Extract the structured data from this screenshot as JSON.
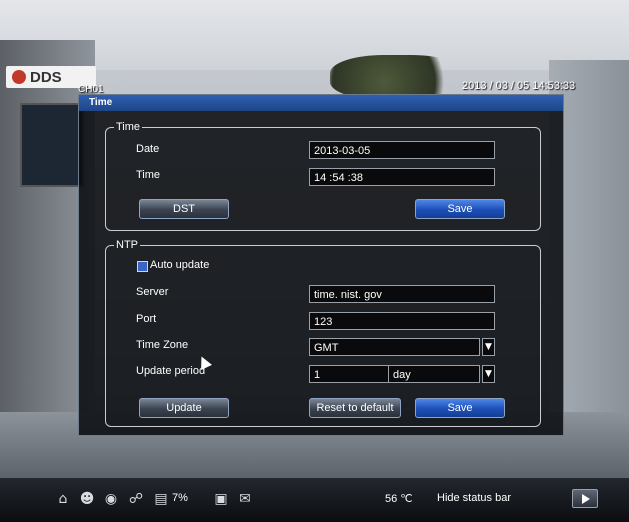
{
  "overlay": {
    "logo_text": "DDS",
    "camera_label": "CH01",
    "camera_timestamp": "2013 / 03 / 05  14:53:33"
  },
  "dialog": {
    "title": "Time",
    "time_group": {
      "legend": "Time",
      "date_label": "Date",
      "date_value": "2013-03-05",
      "time_label": "Time",
      "time_value": "14 :54 :38",
      "dst_button": "DST",
      "save_button": "Save"
    },
    "ntp_group": {
      "legend": "NTP",
      "auto_update_label": "Auto update",
      "auto_update_checked": true,
      "server_label": "Server",
      "server_value": "time. nist. gov",
      "port_label": "Port",
      "port_value": "123",
      "timezone_label": "Time  Zone",
      "timezone_value": "GMT",
      "update_period_label": "Update  period",
      "update_period_value": "1",
      "update_period_unit": "day",
      "update_button": "Update",
      "reset_button": "Reset  to  default",
      "save_button": "Save"
    }
  },
  "statusbar": {
    "network_percent": "7%",
    "temperature": "56  ℃",
    "hide_label": "Hide  status  bar",
    "icons": [
      "home-icon",
      "user-icon",
      "record-icon",
      "network-icon",
      "disk-icon",
      "monitor-icon",
      "mail-icon",
      "next-icon"
    ]
  },
  "colors": {
    "title_bar": "#1e4688",
    "button_blue": "#1c4fb8",
    "checkbox": "#3b64c8"
  }
}
